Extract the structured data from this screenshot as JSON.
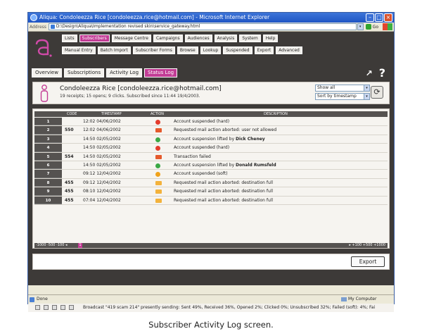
{
  "browser": {
    "title": "Aliqua: Condoleezza Rice [condoleezza.rice@hotmail.com] - Microsoft Internet Explorer",
    "address_label": "Address",
    "url": "D:\\Design\\Aliqua\\Implementation revised skin\\service_gateway.html",
    "go_label": "Go",
    "status": "Done",
    "zone": "My Computer"
  },
  "nav": {
    "row1": [
      "Lists",
      "Subscribers",
      "Message Centre",
      "Campaigns",
      "Audiences",
      "Analysis",
      "System",
      "Help"
    ],
    "row2": [
      "Manual Entry",
      "Batch Import",
      "Subscriber Forms",
      "Browse",
      "Lookup",
      "Suspended",
      "Export",
      "Advanced"
    ]
  },
  "tabs": [
    "Overview",
    "Subscriptions",
    "Activity Log",
    "Status Log"
  ],
  "user": {
    "name": "Condoleezza Rice [condoleezza.rice@hotmail.com]",
    "summary": "19 receipts; 15 opens; 9 clicks. Subscribed since 11:44 19/4/2003.",
    "filter": "Show all",
    "sort": "Sort by timestamp"
  },
  "log": {
    "headers": {
      "code": "CODE",
      "timestamp": "TIMESTAMP",
      "action": "ACTION",
      "description": "DESCRIPTION"
    },
    "rows": [
      {
        "n": "1",
        "code": "",
        "ts": "12:02 04/06/2002",
        "icon": "stop-icon",
        "desc": "Account suspended (hard)",
        "bold": ""
      },
      {
        "n": "2",
        "code": "550",
        "ts": "12:02 04/06/2002",
        "icon": "mail-error-icon",
        "desc": "Requested mail action aborted: user not allowed",
        "bold": ""
      },
      {
        "n": "3",
        "code": "",
        "ts": "14:50 02/05/2002",
        "icon": "ok-icon",
        "desc": "Account suspension lifted by ",
        "bold": "Dick Cheney"
      },
      {
        "n": "4",
        "code": "",
        "ts": "14:50 02/05/2002",
        "icon": "stop-icon",
        "desc": "Account suspended (hard)",
        "bold": ""
      },
      {
        "n": "5",
        "code": "554",
        "ts": "14:50 02/05/2002",
        "icon": "mail-error-icon",
        "desc": "Transaction failed",
        "bold": ""
      },
      {
        "n": "6",
        "code": "",
        "ts": "14:50 02/05/2002",
        "icon": "ok-icon",
        "desc": "Account suspension lifted by ",
        "bold": "Donald Rumsfeld"
      },
      {
        "n": "7",
        "code": "",
        "ts": "09:12 12/04/2002",
        "icon": "soft-stop-icon",
        "desc": "Account suspended (soft)",
        "bold": ""
      },
      {
        "n": "8",
        "code": "455",
        "ts": "09:12 12/04/2002",
        "icon": "mail-warning-icon",
        "desc": "Requested mail action aborted: destination full",
        "bold": ""
      },
      {
        "n": "9",
        "code": "455",
        "ts": "08:10 12/04/2002",
        "icon": "mail-warning-icon",
        "desc": "Requested mail action aborted: destination full",
        "bold": ""
      },
      {
        "n": "10",
        "code": "455",
        "ts": "07:04 12/04/2002",
        "icon": "mail-warning-icon",
        "desc": "Requested mail action aborted: destination full",
        "bold": ""
      }
    ],
    "pager_left": "-1000 -500 -100 ◂",
    "page": "1",
    "pager_right": "▸ +100 +500 +1000"
  },
  "export_label": "Export",
  "broadcast": "Broadcast \"419 scam 214\" presently sending: Sent 49%, Received 36%, Opened 2%; Clicked 0%; Unsubscribed 32%; Failed (soft): 4%; Fai",
  "caption": "Subscriber Activity Log screen."
}
